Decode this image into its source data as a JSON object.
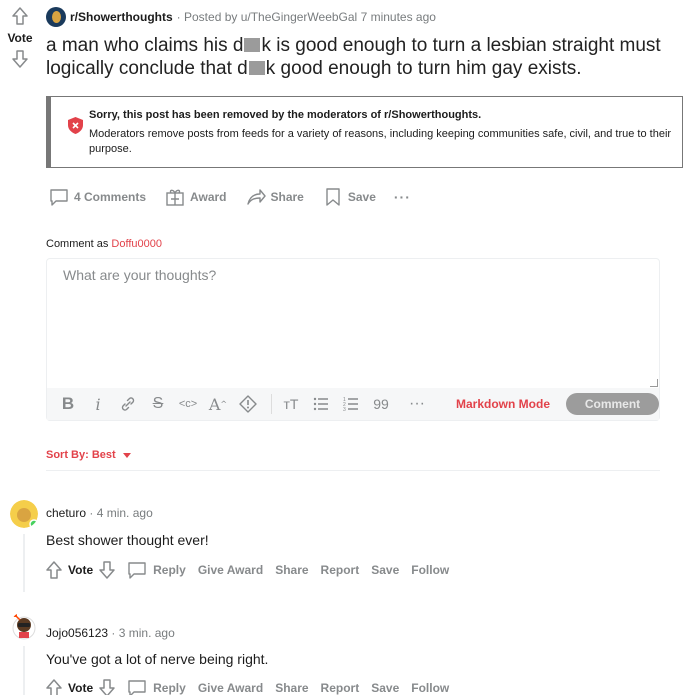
{
  "post": {
    "subreddit": "r/Showerthoughts",
    "posted_by": "· Posted by u/TheGingerWeebGal",
    "time": "7 minutes ago",
    "vote_label": "Vote",
    "title_part1": "a man who claims his d",
    "title_part2": "k is good enough to turn a lesbian straight must logically conclude that d",
    "title_part3": "k good enough to turn him gay exists."
  },
  "removed": {
    "title": "Sorry, this post has been removed by the moderators of r/Showerthoughts.",
    "message": "Moderators remove posts from feeds for a variety of reasons, including keeping communities safe, civil, and true to their purpose."
  },
  "actions": {
    "comments": "4 Comments",
    "award": "Award",
    "share": "Share",
    "save": "Save",
    "more": "···"
  },
  "composer": {
    "comment_as": "Comment as",
    "username": "Doffu0000",
    "placeholder": "What are your thoughts?",
    "markdown_mode": "Markdown Mode",
    "submit": "Comment",
    "toolbar": [
      "B",
      "i",
      "link",
      "S",
      "<c>",
      "A^",
      "spoiler",
      "TT",
      "bulleted-list",
      "numbered-list",
      "99",
      "···"
    ]
  },
  "sort": {
    "label": "Sort By: Best"
  },
  "comments": [
    {
      "author": "cheturo",
      "time": "· 4 min. ago",
      "body": "Best shower thought ever!",
      "vote": "Vote",
      "reply": "Reply",
      "give_award": "Give Award",
      "share": "Share",
      "report": "Report",
      "save": "Save",
      "follow": "Follow"
    },
    {
      "author": "Jojo056123",
      "time": "· 3 min. ago",
      "body": "You've got a lot of nerve being right.",
      "vote": "Vote",
      "reply": "Reply",
      "give_award": "Give Award",
      "share": "Share",
      "report": "Report",
      "save": "Save",
      "follow": "Follow"
    }
  ],
  "colors": {
    "accent": "#e2424a",
    "muted": "#878a8c",
    "button": "#9c9c9c"
  }
}
